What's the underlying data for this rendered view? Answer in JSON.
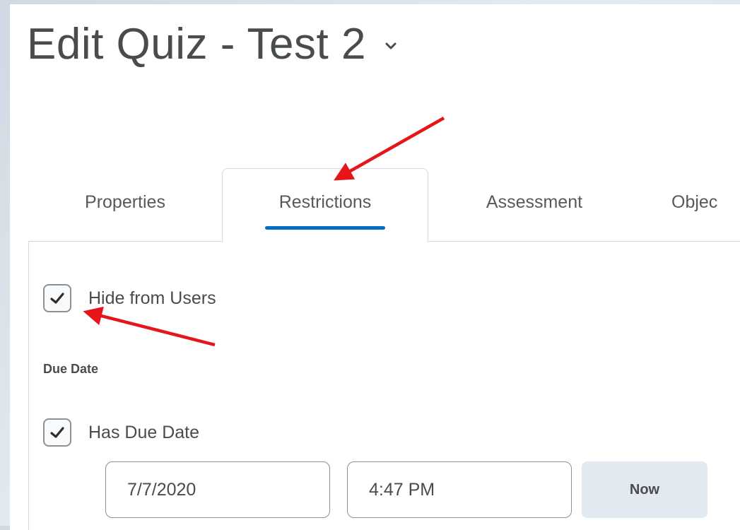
{
  "header": {
    "title": "Edit Quiz - Test 2"
  },
  "tabs": [
    {
      "label": "Properties",
      "active": false
    },
    {
      "label": "Restrictions",
      "active": true
    },
    {
      "label": "Assessment",
      "active": false
    },
    {
      "label": "Objec",
      "active": false
    }
  ],
  "restrictions": {
    "hide_from_users": {
      "label": "Hide from Users",
      "checked": true
    },
    "due_date_section_label": "Due Date",
    "has_due_date": {
      "label": "Has Due Date",
      "checked": true
    },
    "date_value": "7/7/2020",
    "time_value": "4:47 PM",
    "now_button_label": "Now"
  },
  "colors": {
    "accent": "#006fbf",
    "annotation_arrow": "#e5151a"
  },
  "icons": {
    "title_menu": "chevron-down-icon",
    "checkbox": "checkmark-icon"
  }
}
